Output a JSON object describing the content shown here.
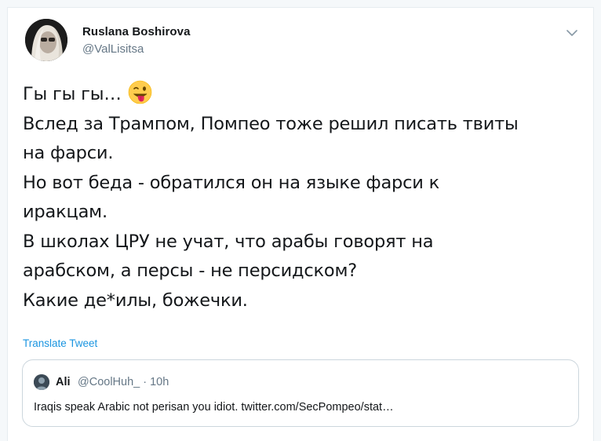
{
  "tweet": {
    "author": {
      "display_name": "Ruslana Boshirova",
      "handle": "@ValLisitsa",
      "avatar_icon": "woman-portrait-avatar"
    },
    "menu_icon": "chevron-down-icon",
    "text_lines": [
      "Гы гы гы…",
      "Вслед за Трампом, Помпео тоже решил писать твиты",
      "на фарси.",
      "Но вот беда - обратился он на языке фарси к",
      "иракцам.",
      "В школах ЦРУ не учат, что арабы говорят на",
      "арабском, а персы - не персидском?",
      "Какие де*илы, божечки."
    ],
    "emoji": "winking-face-with-tongue",
    "translate_label": "Translate Tweet"
  },
  "quoted_tweet": {
    "display_name": "Ali",
    "handle": "@CoolHuh_",
    "separator": "·",
    "time": "10h",
    "meta": "@CoolHuh_ · 10h",
    "text": "Iraqis speak Arabic not perisan you idiot. twitter.com/SecPompeo/stat…"
  },
  "colors": {
    "link": "#1b95e0",
    "secondary_text": "#657786",
    "border": "#ccd6dd",
    "text": "#14171a"
  }
}
